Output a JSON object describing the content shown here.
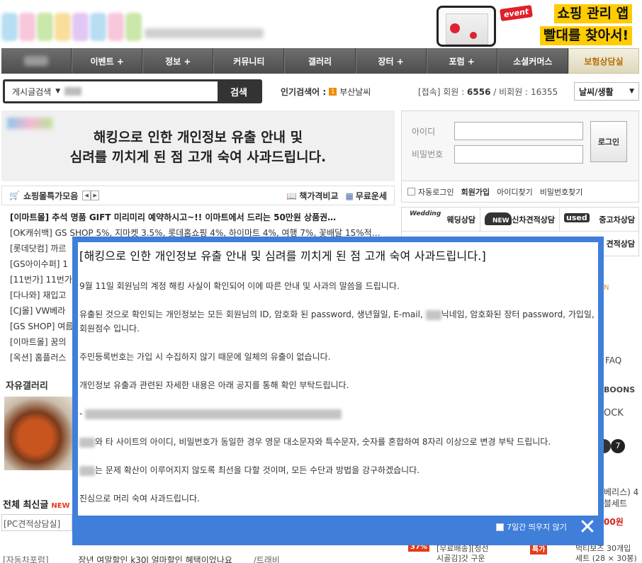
{
  "header": {
    "event_badge": "event",
    "app_ad_line1": "쇼핑 관리 앱",
    "app_ad_line2": "빨대를 찾아서!"
  },
  "nav": {
    "items": [
      "이벤트 +",
      "정보 +",
      "커뮤니티",
      "갤러리",
      "장터 +",
      "포럼 +",
      "소셜커머스",
      "보험상담실"
    ]
  },
  "search": {
    "category": "게시글검색",
    "button": "검색",
    "popular_label": "인기검색어 :",
    "popular_rank": "1",
    "popular_term": "부산날씨",
    "stats_label": "[접속] 회원 :",
    "members": "6556",
    "guest_label": "/ 비회원 :",
    "guests": "16355",
    "weather": "날씨/생활"
  },
  "banner": {
    "line1": "해킹으로 인한 개인정보 유출 안내 및",
    "line2": "심려를 끼치게 된 점 고개 숙여 사과드립니다."
  },
  "login": {
    "id_label": "아이디",
    "pw_label": "비밀번호",
    "button": "로그인",
    "auto_login": "자동로그인",
    "join": "회원가입",
    "find_id": "아이디찾기",
    "find_pw": "비밀번호찾기"
  },
  "deals": {
    "title": "쇼핑몰특가모음",
    "price_compare": "책가격비교",
    "free_fortune": "무료운세",
    "items": [
      "[이마트몰] 추석 명품 GIFT 미리미리 예약하시고~!! 이마트에서 드리는 50만원 상품권…",
      "[OK캐쉬백] GS SHOP 5%, 지마켓 3.5%, 롯데홈쇼핑 4%, 하이마트 4%, 여행 7%, 꽃배달 15%적…",
      "[롯데닷컴] 까르",
      "[GS아이수퍼] 1",
      "[11번가] 11번가",
      "[다나와] 재입고",
      "[CJ몰] VW베라",
      "[GS SHOP] 여름",
      "[이마트몰] 꿈의",
      "[옥션] 홈플러스"
    ]
  },
  "quick": {
    "wedding": "웨딩상담",
    "new_car": "신차견적상담",
    "used_car": "중고차상담",
    "quote": "견적상담",
    "wedding_tag": "Wedding",
    "new_tag": "NEW",
    "used_tag": "used"
  },
  "peek": {
    "faq": "FAQ",
    "boons": "BOONS",
    "ock": "OCK",
    "series": "베리스) 4",
    "set": "블세트",
    "won": "00원",
    "bottom_right": "먹티보즈 30개입",
    "bottom_right2": "세트 (28 × 30봉)",
    "bottom_mid": "[무료배송][청선",
    "bottom_mid2": "시골김]갓 구운",
    "badge1": "37%",
    "badge2": "특가"
  },
  "gallery": {
    "title": "자유갤러리"
  },
  "latest": {
    "title": "전체 최신글",
    "new": "NEW",
    "pc": "[PC견적상담실]",
    "bottom_left": "[자동차포럼]",
    "bottom_text": "장년 여말할인 k30l 얼마할인 혜택이었나요",
    "bottom_tag": "/트래비"
  },
  "modal": {
    "title": "[해킹으로 인한 개인정보 유출 안내 및 심려를 끼치게 된 점 고개 숙여 사과드립니다.]",
    "p1": "9월 11일 회원님의 계정 해킹 사실이 확인되어 이에 따른 안내 및 사과의 말씀을 드립니다.",
    "p2a": "유출된 것으로 확인되는 개인정보는 모든 회원님의 ID, 암호화 된 password, 생년월일, E-mail,",
    "p2b": "닉네임, 암호화된 장터 password,",
    "p2c": "가입일, 회원점수 입니다.",
    "p3": "주민등록번호는 가입 시 수집하지 않기 때문에 일체의 유출이 없습니다.",
    "p4": "개인정보 유출과 관련된 자세한 내용은 아래 공지를 통해 확인 부탁드립니다.",
    "p5_prefix": "-",
    "p6": "와 타 사이트의 아이디, 비밀번호가 동일한 경우 영문 대소문자와 특수문자, 숫자를 혼합하여 8자리 이상으로 변경 부탁 드립니다.",
    "p7": "는 문제 확산이 이루어지지 않도록 최선을 다할 것이며, 모든 수단과 방법을 강구하겠습니다.",
    "p8": "진심으로 머리 숙여 사과드립니다.",
    "no_show": "7일간 띄우지 않기",
    "close": "✕"
  }
}
